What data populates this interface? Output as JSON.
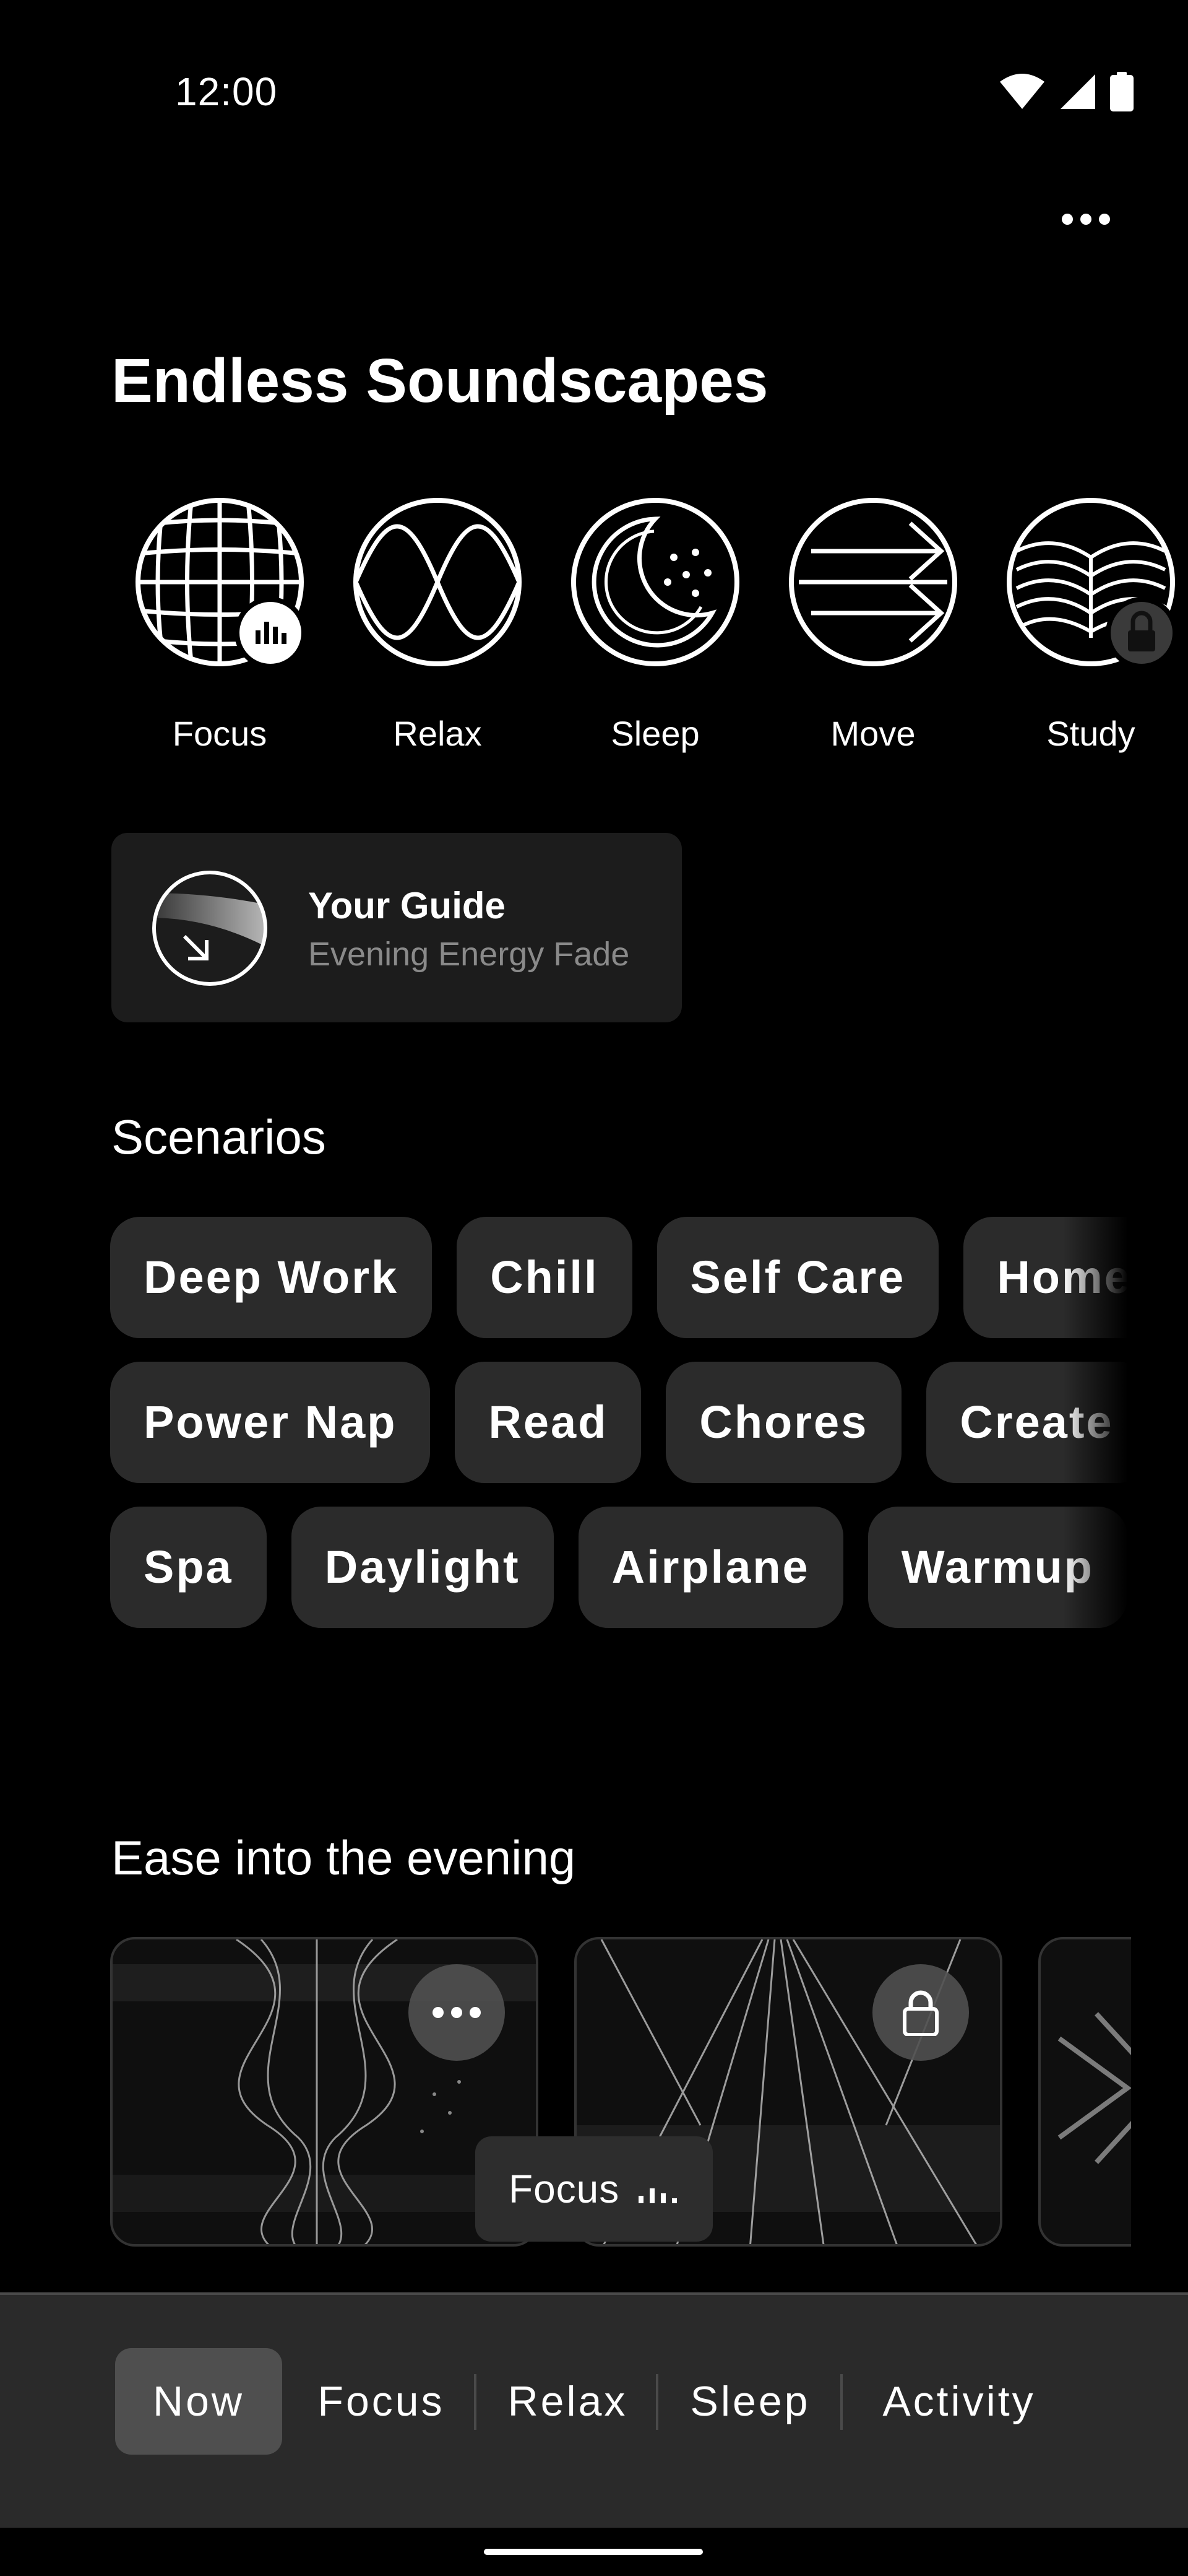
{
  "status_bar": {
    "time": "12:00"
  },
  "header": {
    "title": "Endless Soundscapes"
  },
  "categories": [
    {
      "label": "Focus",
      "icon": "grid-globe-icon",
      "badge": "equalizer-badge-icon"
    },
    {
      "label": "Relax",
      "icon": "sine-wave-icon"
    },
    {
      "label": "Sleep",
      "icon": "moon-stars-icon"
    },
    {
      "label": "Move",
      "icon": "arrows-right-icon"
    },
    {
      "label": "Study",
      "icon": "open-book-icon",
      "badge": "lock-badge-icon"
    }
  ],
  "guide": {
    "title": "Your Guide",
    "subtitle": "Evening Energy Fade"
  },
  "scenarios": {
    "title": "Scenarios",
    "rows": [
      [
        "Deep Work",
        "Chill",
        "Self Care",
        "Homework"
      ],
      [
        "Power Nap",
        "Read",
        "Chores",
        "Create"
      ],
      [
        "Spa",
        "Daylight",
        "Airplane",
        "Warmup"
      ]
    ]
  },
  "evening": {
    "title": "Ease into the evening"
  },
  "now_playing": {
    "label": "Focus",
    "icon": "equalizer-icon"
  },
  "bottom_nav": {
    "tabs": [
      "Now",
      "Focus",
      "Relax",
      "Sleep",
      "Activity"
    ],
    "active": "Now"
  }
}
